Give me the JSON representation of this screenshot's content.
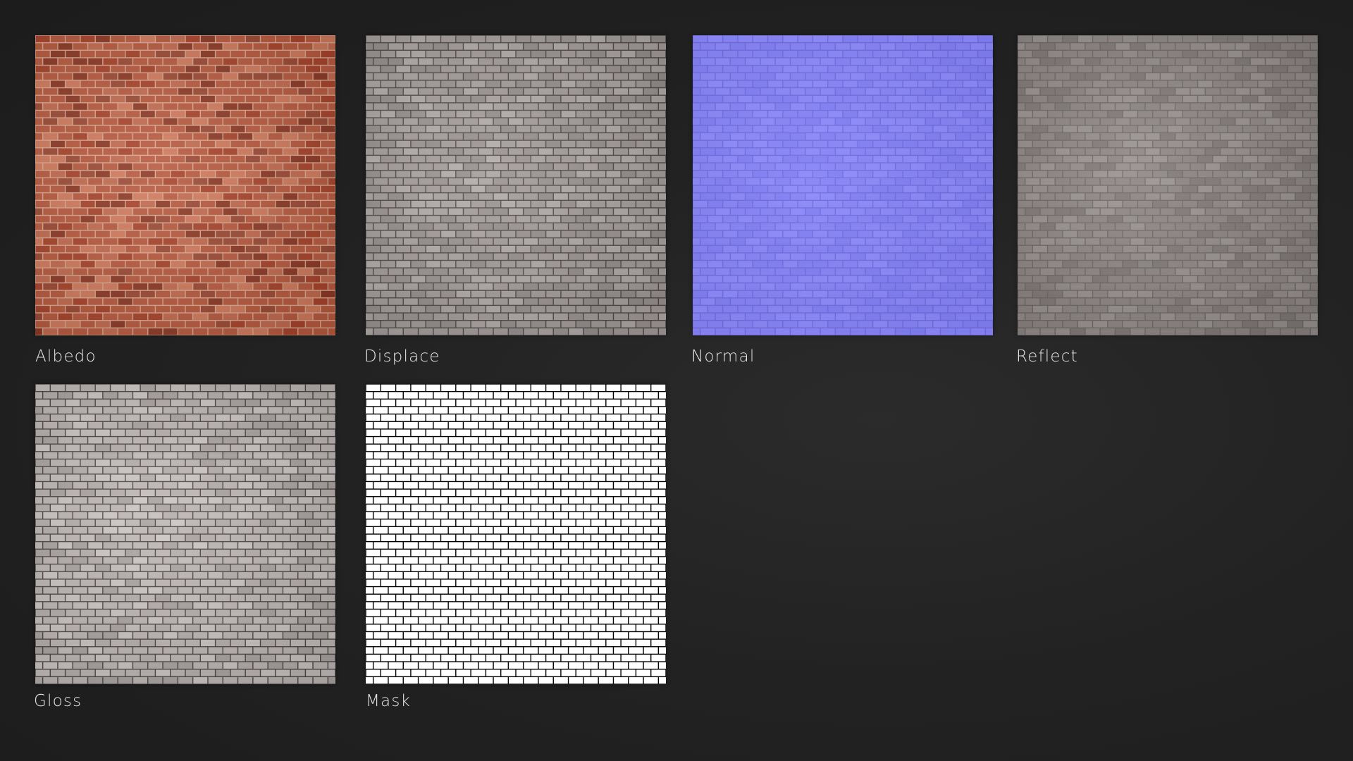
{
  "maps": [
    {
      "label": "Albedo",
      "texture": "red-brick-albedo",
      "base_color": "#b85a40",
      "mortar_color": "#d9a891",
      "variation_colors": [
        "#a8442c",
        "#c26a4f",
        "#8e3a26",
        "#d07a5c",
        "#9c4a35"
      ]
    },
    {
      "label": "Displace",
      "texture": "brick-displacement",
      "base_color": "#a39c9a",
      "mortar_color": "#4e4a49",
      "variation_colors": [
        "#9a9391",
        "#aaa3a1",
        "#b1aba9",
        "#958f8d"
      ]
    },
    {
      "label": "Normal",
      "texture": "brick-normal-map",
      "base_color": "#8683f7",
      "mortar_color": "#6f6cde",
      "variation_colors": [
        "#8a87f9",
        "#817ef4",
        "#8c89fb"
      ]
    },
    {
      "label": "Reflect",
      "texture": "brick-reflection",
      "base_color": "#8c8583",
      "mortar_color": "#6e6866",
      "variation_colors": [
        "#8a8381",
        "#938c8a",
        "#7f7876",
        "#989190"
      ]
    },
    {
      "label": "Gloss",
      "texture": "brick-glossiness",
      "base_color": "#bdb6b4",
      "mortar_color": "#4a4645",
      "variation_colors": [
        "#b5aeac",
        "#c4bebc",
        "#aaa3a1",
        "#cbc5c3"
      ]
    },
    {
      "label": "Mask",
      "texture": "brick-mask",
      "base_color": "#ffffff",
      "mortar_color": "#000000",
      "variation_colors": [
        "#ffffff"
      ]
    }
  ]
}
